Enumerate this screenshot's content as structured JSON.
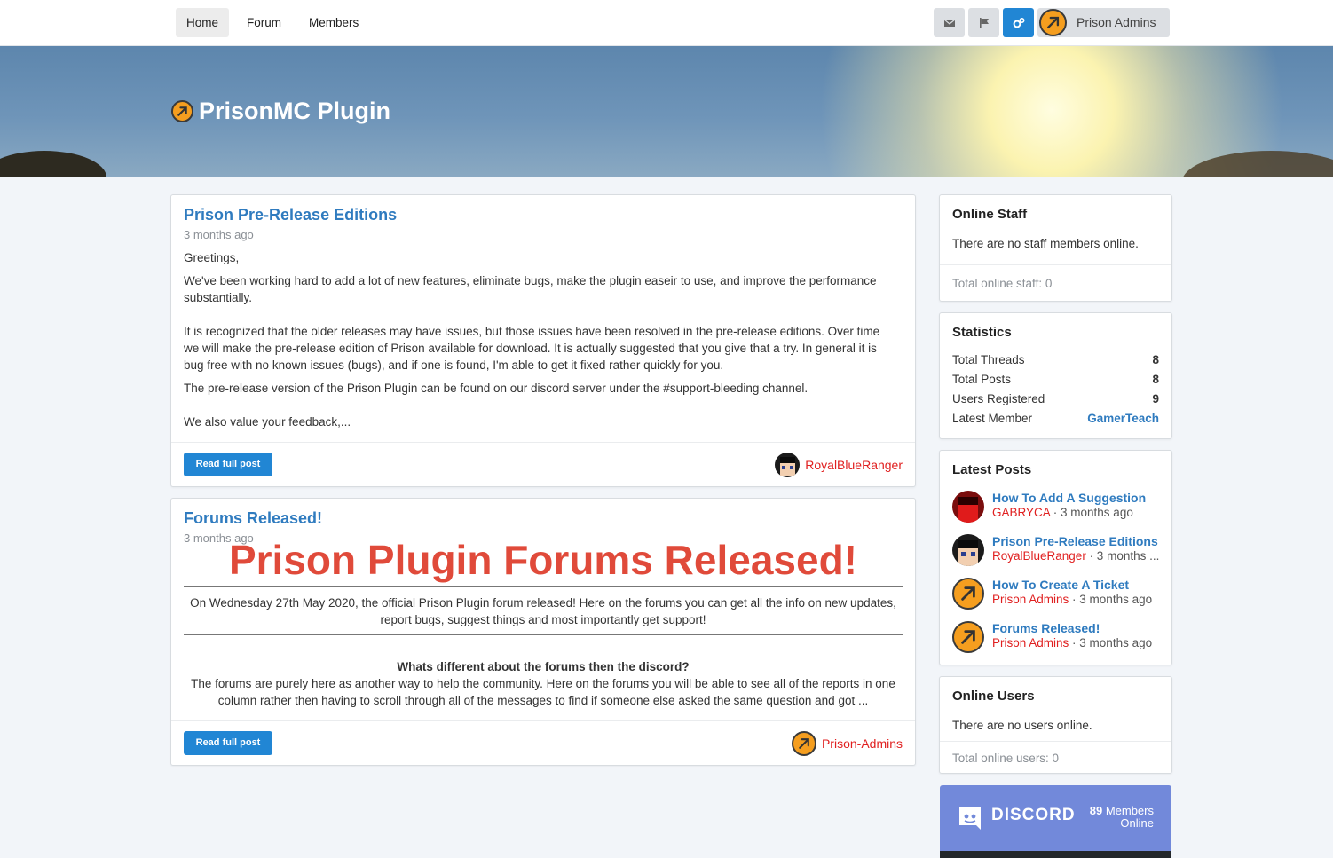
{
  "nav": {
    "home": "Home",
    "forum": "Forum",
    "members": "Members",
    "user_name": "Prison Admins"
  },
  "icons": {
    "mail": "envelope-icon",
    "flag": "flag-icon",
    "admin": "gears-icon",
    "avatar": "pickaxe-avatar-icon"
  },
  "colors": {
    "accent": "#2186d4",
    "link": "#2f7bbf",
    "username_red": "#e02020",
    "heading_red": "#e04a3a",
    "discord": "#7289da"
  },
  "hero": {
    "title": "PrisonMC Plugin"
  },
  "posts": [
    {
      "title": "Prison Pre-Release Editions",
      "date": "3 months ago",
      "p1": "Greetings,",
      "p2": "We've been working hard to add a lot of new features, eliminate bugs, make the plugin easeir to use, and improve the performance substantially.",
      "p3": "It is recognized that the older releases may have issues, but those issues have been resolved in the pre-release editions.  Over time we will make the pre-release edition of Prison available for download.  It is actually suggested that you give that a try.  In general it is bug free with no known issues (bugs), and if one is found, I'm able to get it fixed rather quickly for you.",
      "p4": "The pre-release version of the Prison Plugin can be found on our discord server under the #support-bleeding channel.",
      "p5": "We also value your feedback,...",
      "button": "Read full post",
      "author": "RoyalBlueRanger"
    },
    {
      "title": "Forums Released!",
      "date": "3 months ago",
      "heading": "Prison Plugin Forums Released!",
      "p1": "On Wednesday 27th May 2020, the official Prison Plugin forum released! Here on the forums you can get all the info on new updates, report bugs, suggest things and most importantly get support!",
      "subheading": "Whats different about the forums then the discord?",
      "p2": "The forums are purely here as another way to help the community. Here on the forums you will be able to see all of the reports in one column rather then having to scroll through all of the messages to find if someone else asked the same question and got ...",
      "button": "Read full post",
      "author": "Prison-Admins"
    }
  ],
  "online_staff": {
    "title": "Online Staff",
    "text": "There are no staff members online.",
    "total": "Total online staff: 0"
  },
  "statistics": {
    "title": "Statistics",
    "rows": [
      {
        "label": "Total Threads",
        "value": "8"
      },
      {
        "label": "Total Posts",
        "value": "8"
      },
      {
        "label": "Users Registered",
        "value": "9"
      },
      {
        "label": "Latest Member",
        "value": "GamerTeach"
      }
    ]
  },
  "latest_posts": {
    "title": "Latest Posts",
    "items": [
      {
        "title": "How To Add A Suggestion",
        "user": "GABRYCA",
        "time": " · 3 months ago"
      },
      {
        "title": "Prison Pre-Release Editions",
        "user": "RoyalBlueRanger",
        "time": " · 3 months ..."
      },
      {
        "title": "How To Create A Ticket",
        "user": "Prison Admins",
        "time": " · 3 months ago"
      },
      {
        "title": "Forums Released!",
        "user": "Prison Admins",
        "time": " · 3 months ago"
      }
    ]
  },
  "online_users": {
    "title": "Online Users",
    "text": "There are no users online.",
    "total": "Total online users: 0"
  },
  "discord": {
    "wordmark": "DISCORD",
    "count": "89",
    "members": "Members",
    "online": "Online"
  }
}
